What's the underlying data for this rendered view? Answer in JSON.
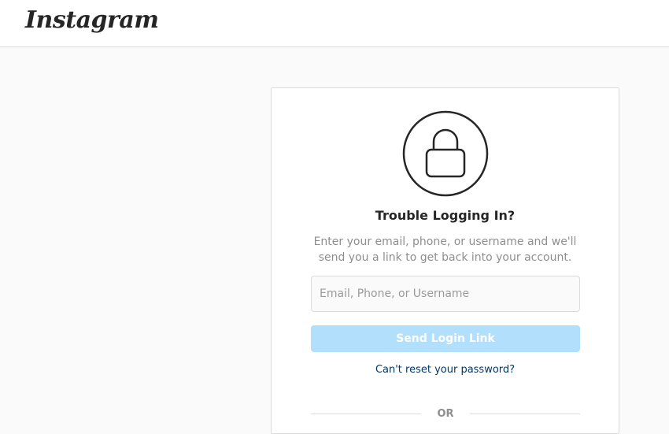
{
  "header": {
    "logo_text": "Instagram"
  },
  "card": {
    "icon": "lock-icon",
    "title": "Trouble Logging In?",
    "description": "Enter your email, phone, or username and we'll send you a link to get back into your account.",
    "input": {
      "placeholder": "Email, Phone, or Username",
      "value": ""
    },
    "send_button_label": "Send Login Link",
    "reset_link_label": "Can't reset your password?",
    "divider_label": "OR"
  },
  "colors": {
    "button_disabled": "#b2dffc",
    "link": "#00376b",
    "border": "#dbdbdb",
    "page_background": "#fafafa"
  }
}
